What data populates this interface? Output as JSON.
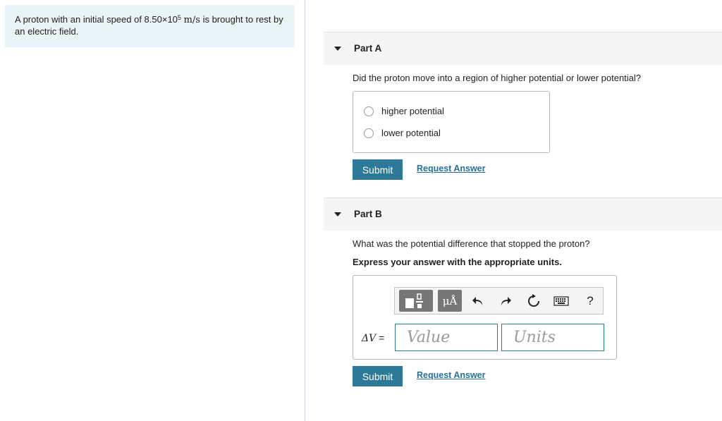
{
  "problem": {
    "text_before": "A proton with an initial speed of 8.50×10",
    "exponent": "5",
    "units": "m/s",
    "text_after": " is brought to rest by an electric field."
  },
  "partA": {
    "title": "Part A",
    "question": "Did the proton move into a region of higher potential or lower potential?",
    "options": [
      "higher potential",
      "lower potential"
    ],
    "submit_label": "Submit",
    "request_label": "Request Answer"
  },
  "partB": {
    "title": "Part B",
    "question": "What was the potential difference that stopped the proton?",
    "instruction": "Express your answer with the appropriate units.",
    "toolbar": {
      "units_btn_label": "μÅ",
      "help_label": "?"
    },
    "answer_label_symbol": "ΔV",
    "answer_label_eq": " =",
    "value_placeholder": "Value",
    "units_placeholder": "Units",
    "submit_label": "Submit",
    "request_label": "Request Answer"
  },
  "colors": {
    "accent": "#2c7a98",
    "problem_bg": "#e9f4f7",
    "link": "#2a6f9a"
  }
}
